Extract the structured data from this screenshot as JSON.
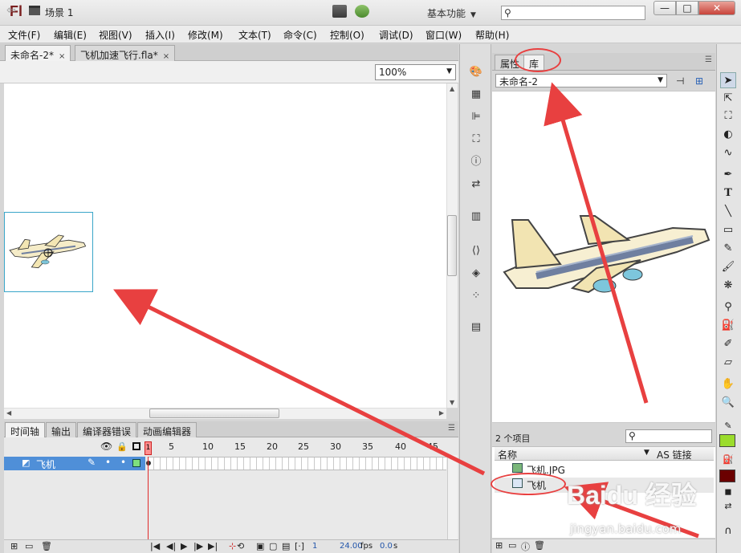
{
  "titlebar": {
    "logo": "Fl",
    "workspace": "基本功能",
    "window_buttons": {
      "minimize": "—",
      "maximize": "□",
      "close": "✕"
    }
  },
  "menu": [
    "文件(F)",
    "编辑(E)",
    "视图(V)",
    "插入(I)",
    "修改(M)",
    "文本(T)",
    "命令(C)",
    "控制(O)",
    "调试(D)",
    "窗口(W)",
    "帮助(H)"
  ],
  "documents": {
    "tabs": [
      {
        "label": "未命名-2*",
        "active": true
      },
      {
        "label": "飞机加速飞行.fla*",
        "active": false
      }
    ],
    "close_glyph": "×"
  },
  "editbar": {
    "scene": "场景 1",
    "zoom": "100%"
  },
  "timeline": {
    "tabs": [
      "时间轴",
      "输出",
      "编译器错误",
      "动画编辑器"
    ],
    "frame_numbers": [
      "1",
      "5",
      "10",
      "15",
      "20",
      "25",
      "30",
      "35",
      "40",
      "45"
    ],
    "layers": [
      {
        "name": "飞机"
      }
    ],
    "current_frame": "1",
    "fps": "24.00",
    "fps_unit": "fps",
    "elapsed": "0.0",
    "elapsed_unit": "s"
  },
  "library": {
    "tabs": [
      {
        "label": "属性",
        "active": false
      },
      {
        "label": "库",
        "active": true
      }
    ],
    "document": "未命名-2",
    "item_count": "2 个项目",
    "columns": {
      "name": "名称",
      "linkage": "AS 链接"
    },
    "items": [
      {
        "name": "飞机.JPG",
        "type": "bitmap",
        "selected": false
      },
      {
        "name": "飞机",
        "type": "graphic",
        "selected": true
      }
    ]
  },
  "watermark": {
    "brand": "Baidu 经验",
    "url": "jingyan.baidu.com"
  },
  "colors": {
    "annotation": "#e84040",
    "layer_highlight": "#4f8fd8",
    "stroke_color": "#9bdc2c",
    "fill_color": "#6b0000",
    "playhead": "#e12b2b"
  }
}
